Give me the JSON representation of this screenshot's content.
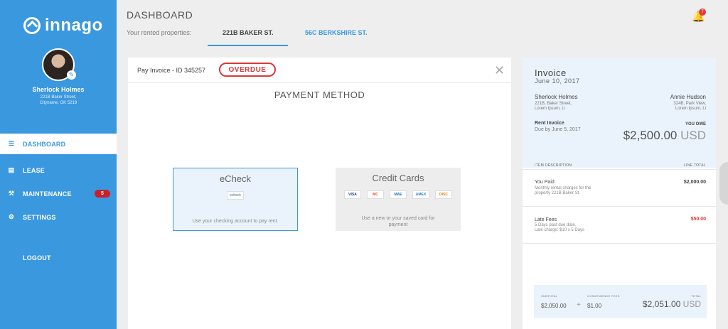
{
  "brand": {
    "name": "innago"
  },
  "user": {
    "name": "Sherlock Holmes",
    "address_line1": "221B Baker Street,",
    "address_line2": "Cityname, OK 5219"
  },
  "nav": [
    {
      "label": "DASHBOARD",
      "icon": "sliders-icon"
    },
    {
      "label": "LEASE",
      "icon": "document-icon"
    },
    {
      "label": "MAINTENANCE",
      "icon": "wrench-icon",
      "badge": "5"
    },
    {
      "label": "SETTINGS",
      "icon": "gear-icon"
    },
    {
      "label": "LOGOUT",
      "icon": ""
    }
  ],
  "header": {
    "title": "DASHBOARD",
    "rented_label": "Your rented properties:",
    "tabs": [
      "221B BAKER ST.",
      "56C BERKSHIRE ST."
    ],
    "notification_count": "7"
  },
  "payment": {
    "invoice_id": "Pay Invoice - ID 345257",
    "status": "OVERDUE",
    "title": "PAYMENT METHOD",
    "echeck": {
      "title": "eCheck",
      "logo": "echeck",
      "desc": "Use your checking account to pay rent."
    },
    "credit": {
      "title": "Credit Cards",
      "cards": [
        "VISA",
        "MC",
        "MAE",
        "AMEX",
        "DISC"
      ],
      "desc_line1": "Use a new or your saved card for",
      "desc_line2": "payment"
    }
  },
  "invoice": {
    "title": "Invoice",
    "date": "June 10, 2017",
    "from": {
      "name": "Sherlock Holmes",
      "line1": "221B, Baker Street,",
      "line2": "Lorem Ipsum, Li"
    },
    "to": {
      "name": "Annie Hudson",
      "line1": "324B, Park View,",
      "line2": "Lorem Ipsum, Li"
    },
    "rent_title": "Rent Invoice",
    "rent_due": "Due by June 5, 2017",
    "you_owe_label": "YOU OWE",
    "you_owe_amount": "$2,500.00",
    "currency": "USD",
    "col_desc": "ITEM DESCRIPTION",
    "col_total": "LINE TOTAL",
    "items": [
      {
        "title": "You Paid",
        "desc1": "Monthly rental charges for the",
        "desc2": "property 221B Baker St.",
        "amount": "$2,000.00"
      },
      {
        "title": "Late Fees",
        "desc1": "5 Days past due date.",
        "desc2": "Late charge: $10 x 5 Days",
        "amount": "$50.00"
      }
    ],
    "totals": {
      "subtotal_label": "SUBTOTAL",
      "subtotal": "$2,050.00",
      "fees_label": "CONVENIENCE FEES",
      "fees": "$1.00",
      "total_label": "TOTAL",
      "total": "$2,051.00"
    }
  },
  "colors": {
    "accent": "#3a98df",
    "danger": "#d83a3a",
    "badge": "#cc1f2b"
  }
}
